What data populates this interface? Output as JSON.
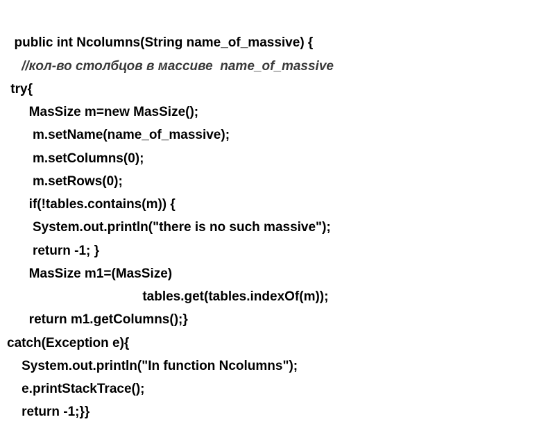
{
  "code": {
    "line1": "  public int Ncolumns(String name_of_massive) {",
    "line2_prefix": "    ",
    "line2_comment": "//кол-во столбцов в массиве  name_of_massive",
    "line3": " try{",
    "line4": "      MasSize m=new MasSize();",
    "line5": "       m.setName(name_of_massive);",
    "line6": "       m.setColumns(0);",
    "line7": "       m.setRows(0);",
    "line8": "      if(!tables.contains(m)) {",
    "line9": "       System.out.println(\"there is no such massive\");",
    "line10": "       return -1; }",
    "line11": "      MasSize m1=(MasSize)",
    "line12": "                                     tables.get(tables.indexOf(m));",
    "line13": "      return m1.getColumns();}",
    "line14": "catch(Exception e){",
    "line15": "    System.out.println(\"In function Ncolumns\");",
    "line16": "    e.printStackTrace();",
    "line17": "    return -1;}}"
  }
}
